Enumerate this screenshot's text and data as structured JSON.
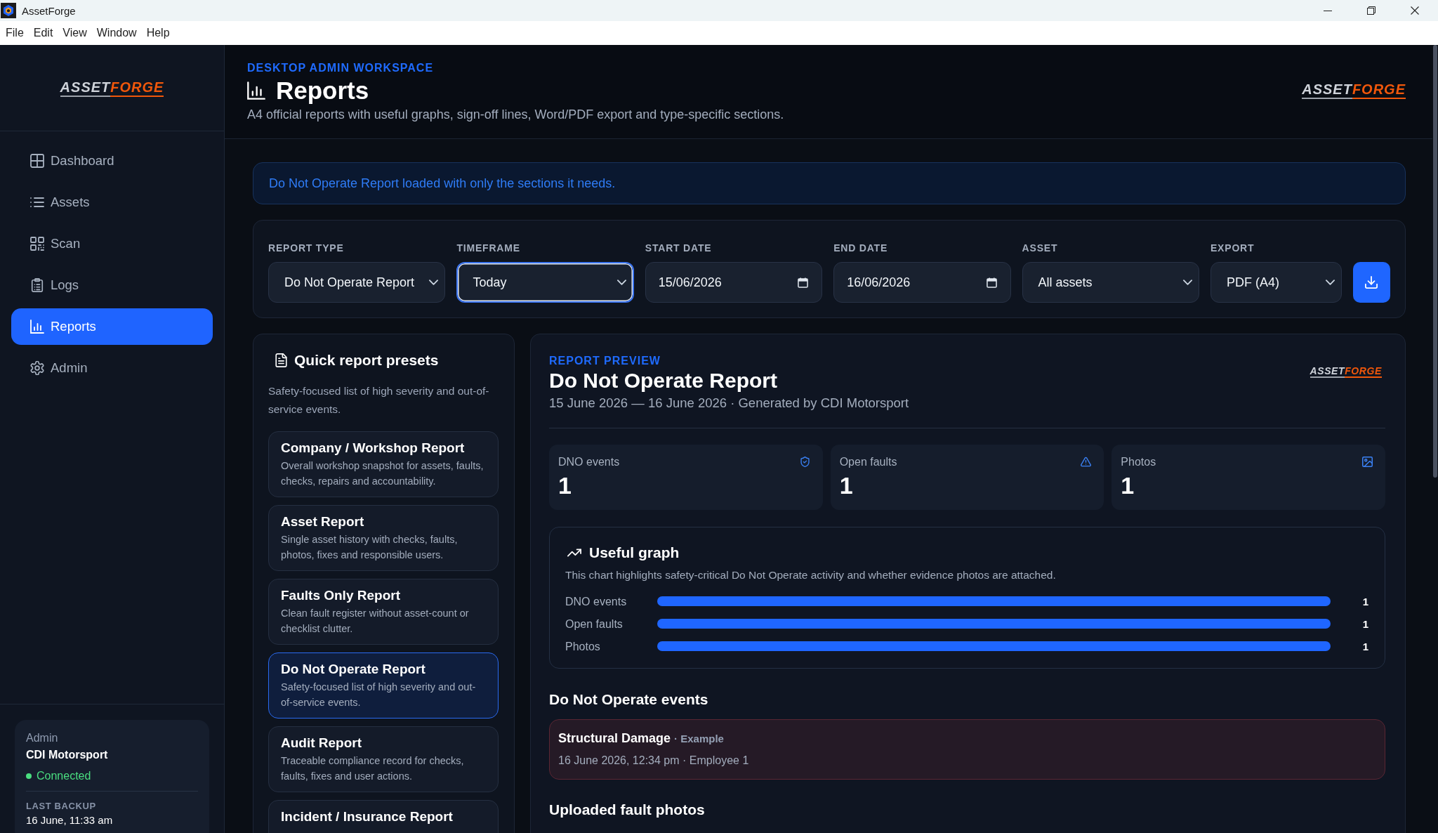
{
  "window": {
    "title": "AssetForge"
  },
  "menu": [
    "File",
    "Edit",
    "View",
    "Window",
    "Help"
  ],
  "sidebar": {
    "logo": [
      "ASSET",
      "FORGE"
    ],
    "items": [
      {
        "label": "Dashboard",
        "selected": false
      },
      {
        "label": "Assets",
        "selected": false
      },
      {
        "label": "Scan",
        "selected": false
      },
      {
        "label": "Logs",
        "selected": false
      },
      {
        "label": "Reports",
        "selected": true
      },
      {
        "label": "Admin",
        "selected": false
      }
    ],
    "account": {
      "role": "Admin",
      "name": "CDI Motorsport",
      "status": "Connected",
      "connected": true,
      "backup_label": "LAST BACKUP",
      "backup_time": "16 June, 11:33 am"
    }
  },
  "header": {
    "overline": "DESKTOP ADMIN WORKSPACE",
    "title": "Reports",
    "subtitle": "A4 official reports with useful graphs, sign-off lines, Word/PDF export and type-specific sections.",
    "logo": [
      "ASSET",
      "FORGE"
    ]
  },
  "notice": "Do Not Operate Report loaded with only the sections it needs.",
  "filters": [
    {
      "kind": "select",
      "label": "REPORT TYPE",
      "value": "Do Not Operate Report",
      "focused": false
    },
    {
      "kind": "select",
      "label": "TIMEFRAME",
      "value": "Today",
      "focused": true
    },
    {
      "kind": "date",
      "label": "START DATE",
      "value": "15/06/2026",
      "focused": false
    },
    {
      "kind": "date",
      "label": "END DATE",
      "value": "16/06/2026",
      "focused": false
    },
    {
      "kind": "select",
      "label": "ASSET",
      "value": "All assets",
      "focused": false
    },
    {
      "kind": "select",
      "label": "EXPORT",
      "value": "PDF (A4)",
      "focused": false
    }
  ],
  "presets": {
    "title": "Quick report presets",
    "description": "Safety-focused list of high severity and out-of-service events.",
    "items": [
      {
        "title": "Company / Workshop Report",
        "description": "Overall workshop snapshot for assets, faults, checks, repairs and accountability.",
        "selected": false
      },
      {
        "title": "Asset Report",
        "description": "Single asset history with checks, faults, photos, fixes and responsible users.",
        "selected": false
      },
      {
        "title": "Faults Only Report",
        "description": "Clean fault register without asset-count or checklist clutter.",
        "selected": false
      },
      {
        "title": "Do Not Operate Report",
        "description": "Safety-focused list of high severity and out-of-service events.",
        "selected": true
      },
      {
        "title": "Audit Report",
        "description": "Traceable compliance record for checks, faults, fixes and user actions.",
        "selected": false
      },
      {
        "title": "Incident / Insurance Report",
        "selected": false
      }
    ]
  },
  "preview": {
    "overline": "REPORT PREVIEW",
    "title": "Do Not Operate Report",
    "meta": "15 June 2026 — 16 June 2026 · Generated by CDI Motorsport",
    "logo": [
      "ASSET",
      "FORGE"
    ],
    "stats": [
      {
        "label": "DNO events",
        "value": "1"
      },
      {
        "label": "Open faults",
        "value": "1"
      },
      {
        "label": "Photos",
        "value": "1"
      }
    ],
    "graph": {
      "title": "Useful graph",
      "description": "This chart highlights safety-critical Do Not Operate activity and whether evidence photos are attached.",
      "chart_data": {
        "type": "bar",
        "orientation": "horizontal",
        "categories": [
          "DNO events",
          "Open faults",
          "Photos"
        ],
        "values": [
          1,
          1,
          1
        ],
        "data_labels": true
      }
    },
    "events_title": "Do Not Operate events",
    "events": [
      {
        "title": "Structural Damage",
        "detail": "· Example",
        "meta": "16 June 2026, 12:34 pm · Employee 1"
      }
    ],
    "photos_title": "Uploaded fault photos"
  }
}
